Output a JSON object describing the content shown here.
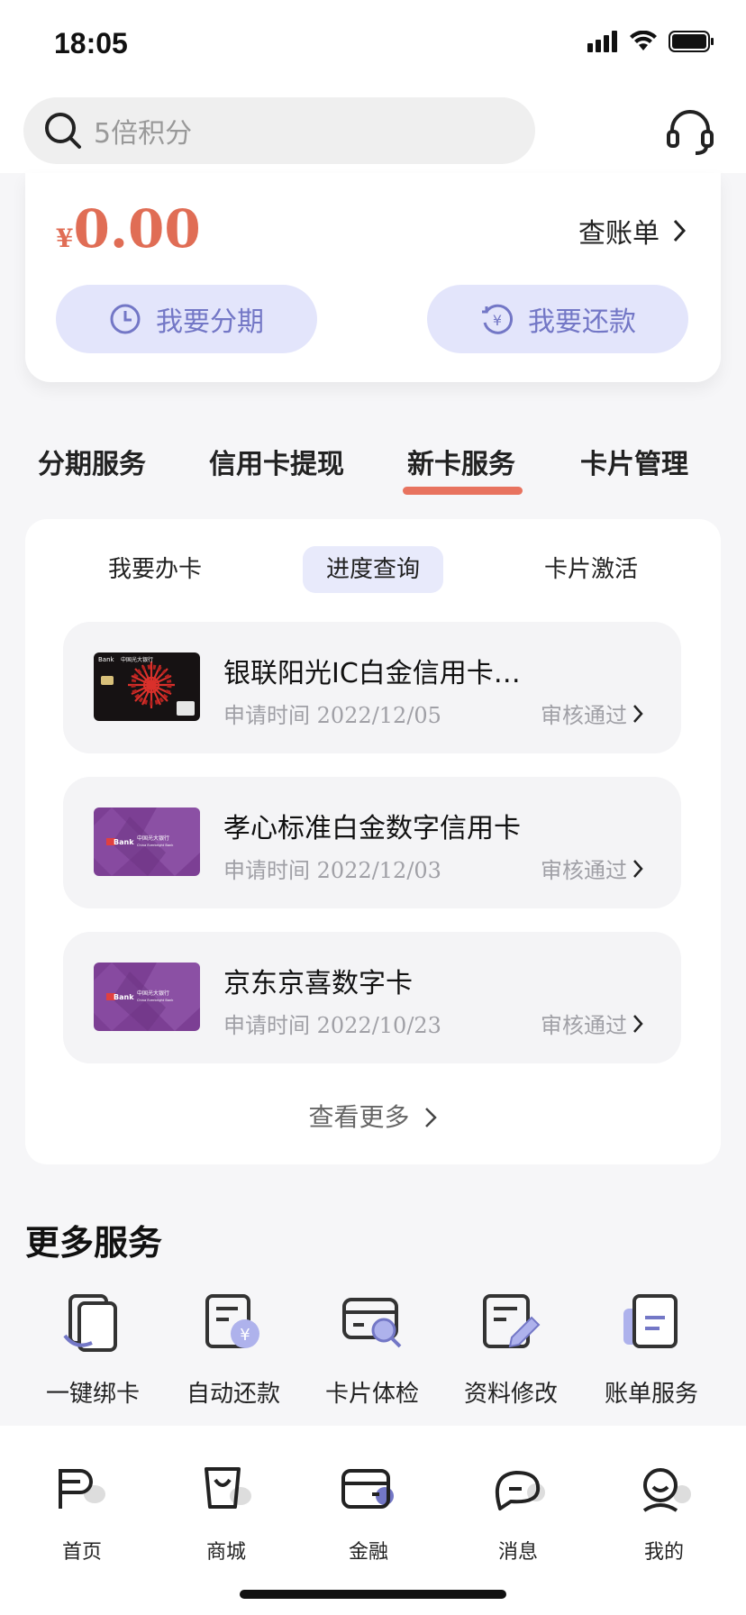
{
  "status_bar": {
    "time": "18:05"
  },
  "search": {
    "placeholder": "5倍积分"
  },
  "summary": {
    "currency": "¥",
    "amount": "0.00",
    "bill_link": "查账单",
    "installment_button": "我要分期",
    "repay_button": "我要还款"
  },
  "tabs": [
    {
      "label": "分期服务"
    },
    {
      "label": "信用卡提现"
    },
    {
      "label": "新卡服务",
      "active": true
    },
    {
      "label": "卡片管理"
    }
  ],
  "subtabs": [
    {
      "label": "我要办卡"
    },
    {
      "label": "进度查询",
      "active": true
    },
    {
      "label": "卡片激活"
    }
  ],
  "applications": [
    {
      "title": "银联阳光IC白金信用卡…",
      "date_label": "申请时间 2022/12/05",
      "status": "审核通过",
      "card_style": "black"
    },
    {
      "title": "孝心标准白金数字信用卡",
      "date_label": "申请时间 2022/12/03",
      "status": "审核通过",
      "card_style": "purple"
    },
    {
      "title": "京东京喜数字卡",
      "date_label": "申请时间 2022/10/23",
      "status": "审核通过",
      "card_style": "purple"
    }
  ],
  "card_thumb_text": {
    "bank_cn": "中国光大银行",
    "bank_en": "China Everbright Bank",
    "logo": "Bank"
  },
  "view_more": "查看更多",
  "more_services": {
    "title": "更多服务",
    "items": [
      {
        "label": "一键绑卡",
        "icon": "bind-card-icon"
      },
      {
        "label": "自动还款",
        "icon": "auto-repay-icon"
      },
      {
        "label": "卡片体检",
        "icon": "card-check-icon"
      },
      {
        "label": "资料修改",
        "icon": "edit-info-icon"
      },
      {
        "label": "账单服务",
        "icon": "bill-service-icon"
      }
    ]
  },
  "tabbar": [
    {
      "label": "首页",
      "icon": "home-icon"
    },
    {
      "label": "商城",
      "icon": "mall-icon"
    },
    {
      "label": "金融",
      "icon": "finance-icon",
      "active": true
    },
    {
      "label": "消息",
      "icon": "message-icon"
    },
    {
      "label": "我的",
      "icon": "profile-icon"
    }
  ],
  "colors": {
    "accent": "#e8735f",
    "pill_bg": "#e3e5fb",
    "pill_text": "#7377c6",
    "purple_card": "#7c3f94"
  }
}
